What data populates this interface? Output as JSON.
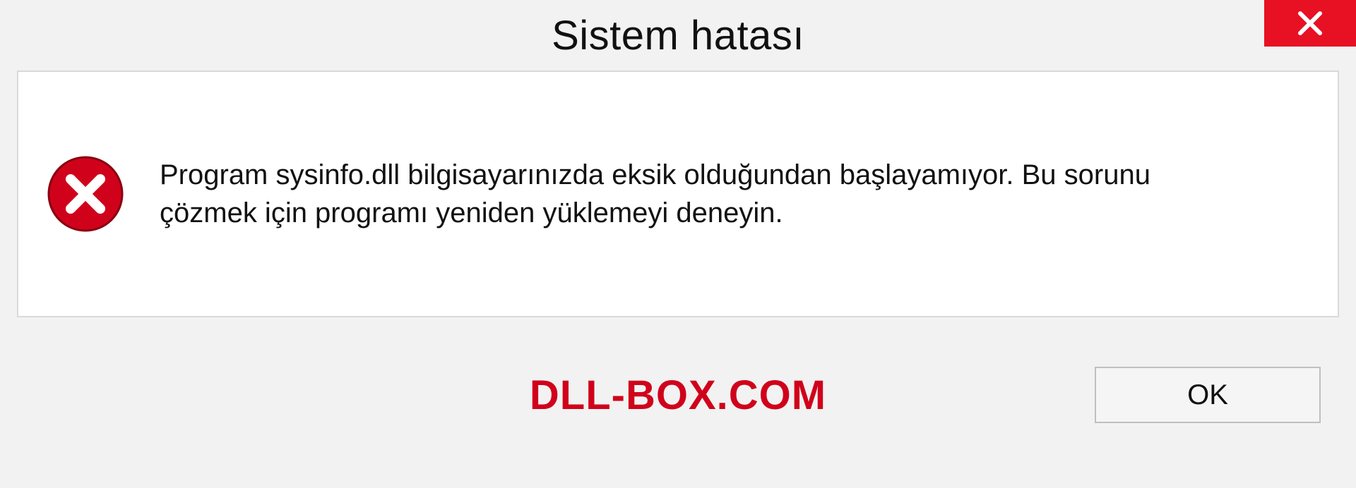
{
  "dialog": {
    "title": "Sistem hatası",
    "message": "Program sysinfo.dll bilgisayarınızda eksik olduğundan başlayamıyor. Bu sorunu çözmek için programı yeniden yüklemeyi deneyin.",
    "ok_label": "OK",
    "brand": "DLL-BOX.COM",
    "colors": {
      "close_bg": "#e81123",
      "error_icon": "#d0021b",
      "brand_text": "#d0021b"
    }
  }
}
